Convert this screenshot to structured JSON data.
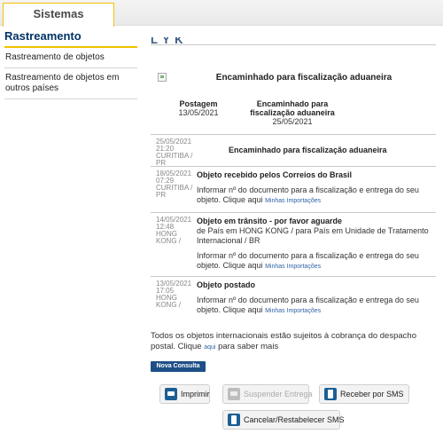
{
  "topbar": {
    "tab_label": "Sistemas"
  },
  "sidebar": {
    "title": "Rastreamento",
    "items": [
      {
        "label": "Rastreamento de objetos"
      },
      {
        "label": "Rastreamento de objetos em outros países"
      }
    ]
  },
  "main": {
    "cut_heading": "L          Y      K",
    "head_status": "Encaminhado para fiscalização aduaneira",
    "summary": {
      "postagem_label": "Postagem",
      "postagem_date": "13/05/2021",
      "status_label": "Encaminhado para fiscalização aduaneira",
      "status_date": "25/05/2021"
    },
    "events": [
      {
        "date": "25/05/2021",
        "time": "21:20",
        "location": "CURITIBA / PR",
        "title": "Encaminhado para fiscalização aduaneira"
      },
      {
        "date": "18/05/2021",
        "time": "07:29",
        "location": "CURITIBA / PR",
        "title": "Objeto recebido pelos Correios do Brasil",
        "info": "Informar nº do documento para a fiscalização e entrega do seu objeto. Clique aqui",
        "link": "Minhas Importações"
      },
      {
        "date": "14/05/2021",
        "time": "12:48",
        "location": "HONG KONG /",
        "title": "Objeto em trânsito - por favor aguarde",
        "detail": "de País em HONG KONG / para País em Unidade de Tratamento Internacional / BR",
        "info": "Informar nº do documento para a fiscalização e entrega do seu objeto. Clique aqui",
        "link": "Minhas Importações"
      },
      {
        "date": "13/05/2021",
        "time": "17:05",
        "location": "HONG KONG /",
        "title": "Objeto postado",
        "info": "Informar nº do documento para a fiscalização e entrega do seu objeto. Clique aqui",
        "link": "Minhas Importações"
      }
    ],
    "note_text": "Todos os objetos internacionais estão sujeitos à cobrança do despacho postal. Clique",
    "note_link": "aqui",
    "note_tail": "para saber mais",
    "nova_consulta": "Nova Consulta",
    "actions": {
      "imprimir": "Imprimir",
      "suspender": "Suspender Entrega",
      "sms": "Receber por SMS",
      "cancelar_sms": "Cancelar/Restabelecer SMS"
    }
  }
}
